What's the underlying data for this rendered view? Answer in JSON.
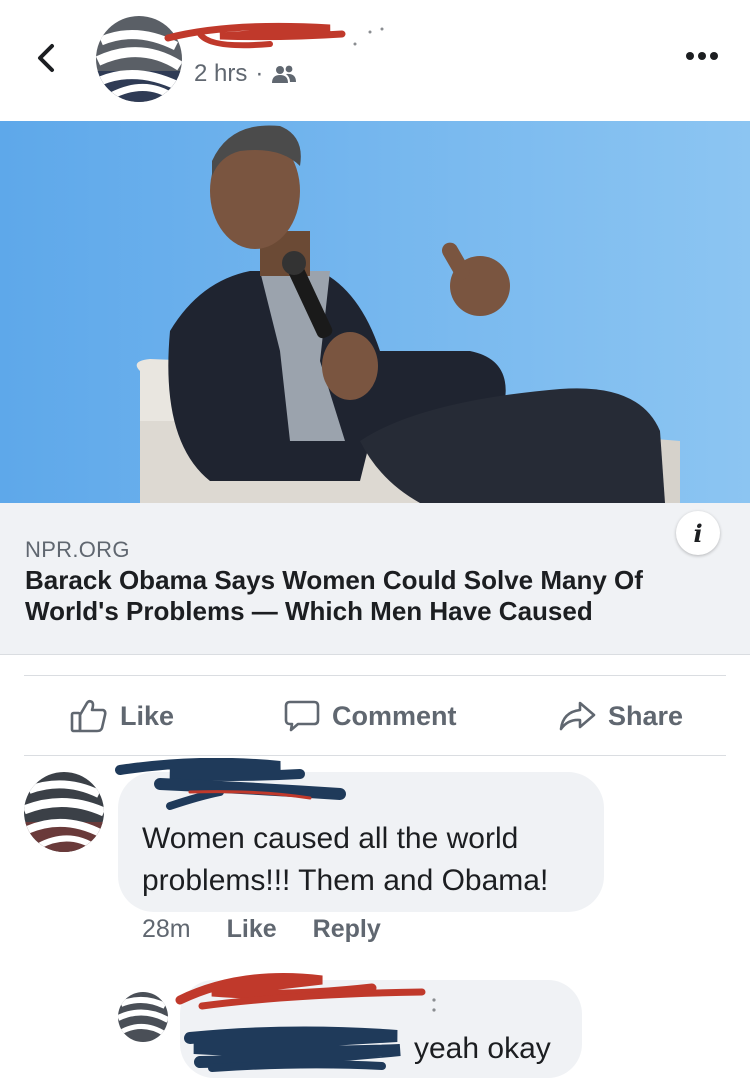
{
  "post": {
    "time": "2 hrs",
    "separator": "·",
    "audience_icon": "friends-icon"
  },
  "link": {
    "domain": "NPR.ORG",
    "title": "Barack Obama Says Women Could Solve Many Of World's Problems — Which Men Have Caused",
    "info_label": "i"
  },
  "actions": {
    "like": "Like",
    "comment": "Comment",
    "share": "Share"
  },
  "comments": [
    {
      "text": "Women caused all the world problems!!! Them and Obama!",
      "time": "28m",
      "like": "Like",
      "reply": "Reply"
    },
    {
      "text": "yeah okay"
    }
  ],
  "colors": {
    "redaction_red": "#c0392b",
    "redaction_navy": "#1f3a5a",
    "photo_background": "#6fb3ee"
  }
}
